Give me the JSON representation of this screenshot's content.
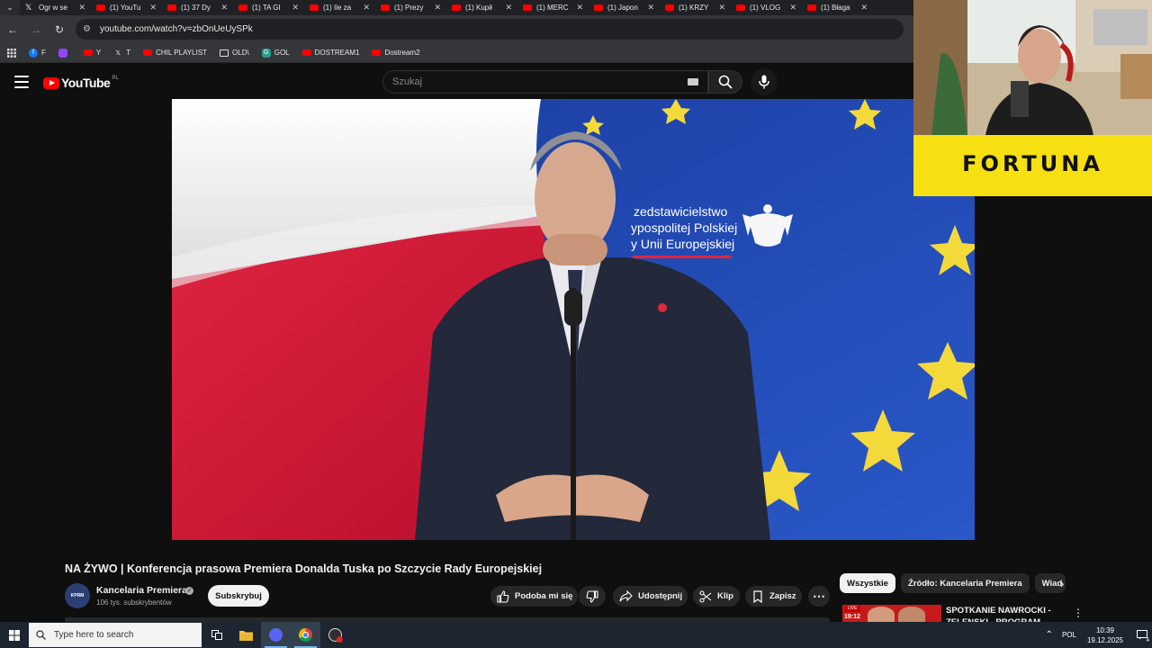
{
  "browser": {
    "tabs": [
      {
        "label": "Ogr w se",
        "favicon": "x-icon"
      },
      {
        "label": "(1) YouTu",
        "favicon": "youtube-icon"
      },
      {
        "label": "(1) 37 Dy",
        "favicon": "youtube-icon"
      },
      {
        "label": "(1) TA GI",
        "favicon": "youtube-icon"
      },
      {
        "label": "(1) Ile za",
        "favicon": "youtube-icon"
      },
      {
        "label": "(1) Prezy",
        "favicon": "youtube-icon"
      },
      {
        "label": "(1) Kupił",
        "favicon": "youtube-icon"
      },
      {
        "label": "(1) MERC",
        "favicon": "youtube-icon"
      },
      {
        "label": "(1) Japon",
        "favicon": "youtube-icon"
      },
      {
        "label": "(1) KRZY",
        "favicon": "youtube-icon"
      },
      {
        "label": "(1) VLOG",
        "favicon": "youtube-icon"
      },
      {
        "label": "(1) Błaga",
        "favicon": "youtube-icon"
      }
    ],
    "url": "youtube.com/watch?v=zbOnUeUySPk",
    "bookmarks": [
      {
        "label": "F",
        "icon": "facebook-icon",
        "color": "#1877f2"
      },
      {
        "label": "",
        "icon": "twitch-icon",
        "color": "#9146ff"
      },
      {
        "label": "Y",
        "icon": "youtube-icon",
        "color": "#ff0000"
      },
      {
        "label": "T",
        "icon": "x-icon",
        "color": "#000000"
      },
      {
        "label": "CHIL PLAYLIST",
        "icon": "youtube-icon",
        "color": "#ff0000"
      },
      {
        "label": "OLD\\",
        "icon": "folder-icon",
        "color": "#35363a"
      },
      {
        "label": "GOL",
        "icon": "g-icon",
        "color": "#2a9d8f"
      },
      {
        "label": "DOSTREAM1",
        "icon": "youtube-icon",
        "color": "#ff0000"
      },
      {
        "label": "Dostream2",
        "icon": "youtube-icon",
        "color": "#ff0000"
      }
    ]
  },
  "youtube": {
    "logo_text": "YouTube",
    "country_code": "PL",
    "search_placeholder": "Szukaj",
    "video": {
      "banner_line1": "zedstawicielstwo",
      "banner_line2": "ypospolitej Polskiej",
      "banner_line3": "y Unii Europejskiej"
    },
    "title": "NA ŻYWO | Konferencja prasowa Premiera Donalda Tuska po Szczycie Rady Europejskiej",
    "channel": {
      "name": "Kancelaria Premiera",
      "avatar_text": "KPRM",
      "subscribers": "106 tys. subskrybentów",
      "subscribe_label": "Subskrybuj"
    },
    "actions": {
      "like_label": "Podoba mi się",
      "share_label": "Udostępnij",
      "clip_label": "Klip",
      "save_label": "Zapisz"
    },
    "chips": [
      "Wszystkie",
      "Źródło: Kancelaria Premiera",
      "Wiad"
    ],
    "sidebar_item": {
      "live_badge": "LIVE",
      "time_badge": "19:12",
      "title": "SPOTKANIE NAWROCKI - ZELENSKI - PROGRAM"
    }
  },
  "overlay": {
    "sponsor": "FORTUNA"
  },
  "taskbar": {
    "search_placeholder": "Type here to search",
    "language": "POL",
    "time": "10:39",
    "date": "19.12.2025",
    "notification_count": "4"
  },
  "colors": {
    "youtube_red": "#ff0000",
    "fortuna_yellow": "#f6e012",
    "eu_blue": "#1d3fa0",
    "poland_red": "#dc143c"
  }
}
